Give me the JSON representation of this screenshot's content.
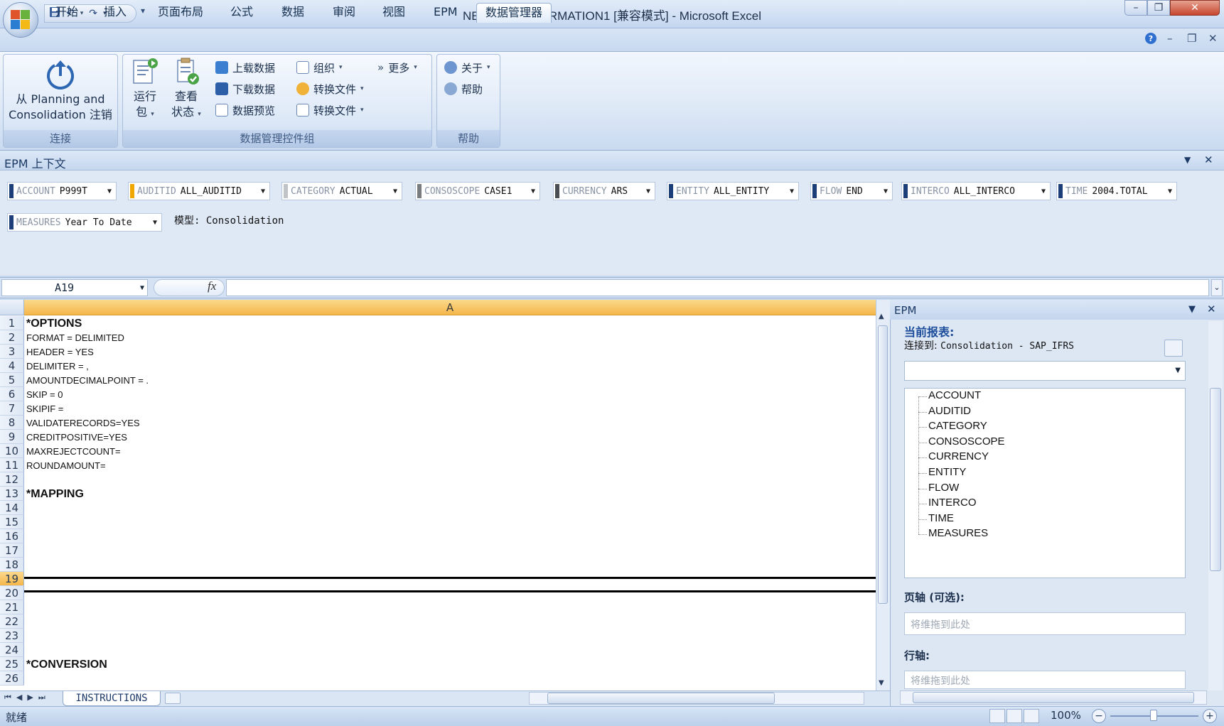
{
  "window": {
    "title": "NEWTRANSFORMATION1  [兼容模式] - Microsoft Excel",
    "min": "–",
    "max": "❐",
    "close": "✕",
    "qat_more": "▾"
  },
  "tabs": [
    "开始",
    "插入",
    "页面布局",
    "公式",
    "数据",
    "审阅",
    "视图",
    "EPM",
    "数据管理器"
  ],
  "active_tab": "数据管理器",
  "ribbon": {
    "groups": {
      "connect": {
        "label": "连接",
        "button_line1": "从 Planning and",
        "button_line2": "Consolidation 注销"
      },
      "datamanager": {
        "label": "数据管理控件组",
        "run_line1": "运行",
        "run_line2": "包",
        "view_line1": "查看",
        "view_line2": "状态",
        "upload": "上载数据",
        "download": "下载数据",
        "preview": "数据预览",
        "organize": "组织",
        "transform1": "转换文件",
        "transform2": "转换文件",
        "more": "更多"
      },
      "help": {
        "label": "帮助",
        "about": "关于",
        "help": "帮助"
      }
    }
  },
  "epm_context": {
    "title": "EPM 上下文",
    "dims": [
      {
        "dim": "ACCOUNT",
        "value": "P999T",
        "color": "#1c3f7a"
      },
      {
        "dim": "AUDITID",
        "value": "ALL_AUDITID",
        "color": "#f0a800"
      },
      {
        "dim": "CATEGORY",
        "value": "ACTUAL",
        "color": "#c0c4c8"
      },
      {
        "dim": "CONSOSCOPE",
        "value": "CASE1",
        "color": "#7a7d80"
      },
      {
        "dim": "CURRENCY",
        "value": "ARS",
        "color": "#4a4d52"
      },
      {
        "dim": "ENTITY",
        "value": "ALL_ENTITY",
        "color": "#1c3f7a"
      },
      {
        "dim": "FLOW",
        "value": "END",
        "color": "#1c3f7a"
      },
      {
        "dim": "INTERCO",
        "value": "ALL_INTERCO",
        "color": "#1c3f7a"
      },
      {
        "dim": "TIME",
        "value": "2004.TOTAL",
        "color": "#1c3f7a"
      },
      {
        "dim": "MEASURES",
        "value": "Year To Date",
        "color": "#1c3f7a"
      }
    ],
    "model_label": "模型: Consolidation"
  },
  "formula_bar": {
    "namebox": "A19",
    "fx": "fx",
    "value": ""
  },
  "sheet": {
    "column": "A",
    "selected_row": 19,
    "rows": [
      {
        "n": "1",
        "text": "*OPTIONS",
        "hdr": true
      },
      {
        "n": "2",
        "text": "FORMAT = DELIMITED"
      },
      {
        "n": "3",
        "text": "HEADER = YES"
      },
      {
        "n": "4",
        "text": "DELIMITER = ,"
      },
      {
        "n": "5",
        "text": "AMOUNTDECIMALPOINT = ."
      },
      {
        "n": "6",
        "text": "SKIP = 0"
      },
      {
        "n": "7",
        "text": "SKIPIF ="
      },
      {
        "n": "8",
        "text": "VALIDATERECORDS=YES"
      },
      {
        "n": "9",
        "text": "CREDITPOSITIVE=YES"
      },
      {
        "n": "10",
        "text": "MAXREJECTCOUNT="
      },
      {
        "n": "11",
        "text": "ROUNDAMOUNT="
      },
      {
        "n": "12",
        "text": ""
      },
      {
        "n": "13",
        "text": "*MAPPING",
        "hdr": true
      },
      {
        "n": "14",
        "text": ""
      },
      {
        "n": "15",
        "text": ""
      },
      {
        "n": "16",
        "text": ""
      },
      {
        "n": "17",
        "text": ""
      },
      {
        "n": "18",
        "text": ""
      },
      {
        "n": "19",
        "text": ""
      },
      {
        "n": "20",
        "text": ""
      },
      {
        "n": "21",
        "text": ""
      },
      {
        "n": "22",
        "text": ""
      },
      {
        "n": "23",
        "text": ""
      },
      {
        "n": "24",
        "text": ""
      },
      {
        "n": "25",
        "text": "*CONVERSION",
        "hdr": true
      },
      {
        "n": "26",
        "text": ""
      }
    ],
    "tab_name": "INSTRUCTIONS"
  },
  "epm_pane": {
    "title": "EPM",
    "current_report": "当前报表:",
    "connected_label": "连接到:",
    "connected_value": "Consolidation - SAP_IFRS",
    "dimensions": [
      "ACCOUNT",
      "AUDITID",
      "CATEGORY",
      "CONSOSCOPE",
      "CURRENCY",
      "ENTITY",
      "FLOW",
      "INTERCO",
      "TIME",
      "MEASURES"
    ],
    "page_axis_label": "页轴 (可选):",
    "row_axis_label": "行轴:",
    "drop_placeholder": "将维拖到此处"
  },
  "statusbar": {
    "status": "就绪",
    "zoom": "100%"
  }
}
